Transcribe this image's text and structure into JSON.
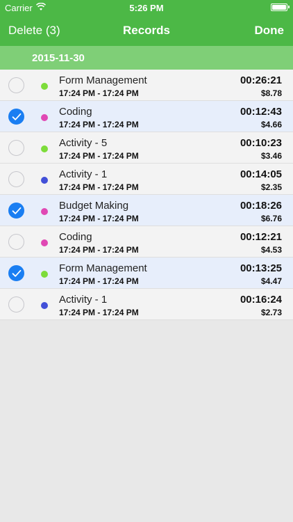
{
  "status_bar": {
    "carrier": "Carrier",
    "time": "5:26 PM"
  },
  "nav": {
    "left": "Delete (3)",
    "title": "Records",
    "right": "Done"
  },
  "section": {
    "date": "2015-11-30"
  },
  "colors": {
    "header": "#4cb846",
    "section": "#7fcf77",
    "selected": "#e7eefb",
    "check": "#1a7ef2"
  },
  "records": [
    {
      "name": "Form Management",
      "range": "17:24 PM - 17:24 PM",
      "duration": "00:26:21",
      "cost": "$8.78",
      "color": "#7ddc3a",
      "selected": false
    },
    {
      "name": "Coding",
      "range": "17:24 PM - 17:24 PM",
      "duration": "00:12:43",
      "cost": "$4.66",
      "color": "#e048b4",
      "selected": true
    },
    {
      "name": "Activity - 5",
      "range": "17:24 PM - 17:24 PM",
      "duration": "00:10:23",
      "cost": "$3.46",
      "color": "#7ddc3a",
      "selected": false
    },
    {
      "name": "Activity - 1",
      "range": "17:24 PM - 17:24 PM",
      "duration": "00:14:05",
      "cost": "$2.35",
      "color": "#4250d8",
      "selected": false
    },
    {
      "name": "Budget Making",
      "range": "17:24 PM - 17:24 PM",
      "duration": "00:18:26",
      "cost": "$6.76",
      "color": "#e048b4",
      "selected": true
    },
    {
      "name": "Coding",
      "range": "17:24 PM - 17:24 PM",
      "duration": "00:12:21",
      "cost": "$4.53",
      "color": "#e048b4",
      "selected": false
    },
    {
      "name": "Form Management",
      "range": "17:24 PM - 17:24 PM",
      "duration": "00:13:25",
      "cost": "$4.47",
      "color": "#7ddc3a",
      "selected": true
    },
    {
      "name": "Activity - 1",
      "range": "17:24 PM - 17:24 PM",
      "duration": "00:16:24",
      "cost": "$2.73",
      "color": "#4250d8",
      "selected": false
    }
  ]
}
